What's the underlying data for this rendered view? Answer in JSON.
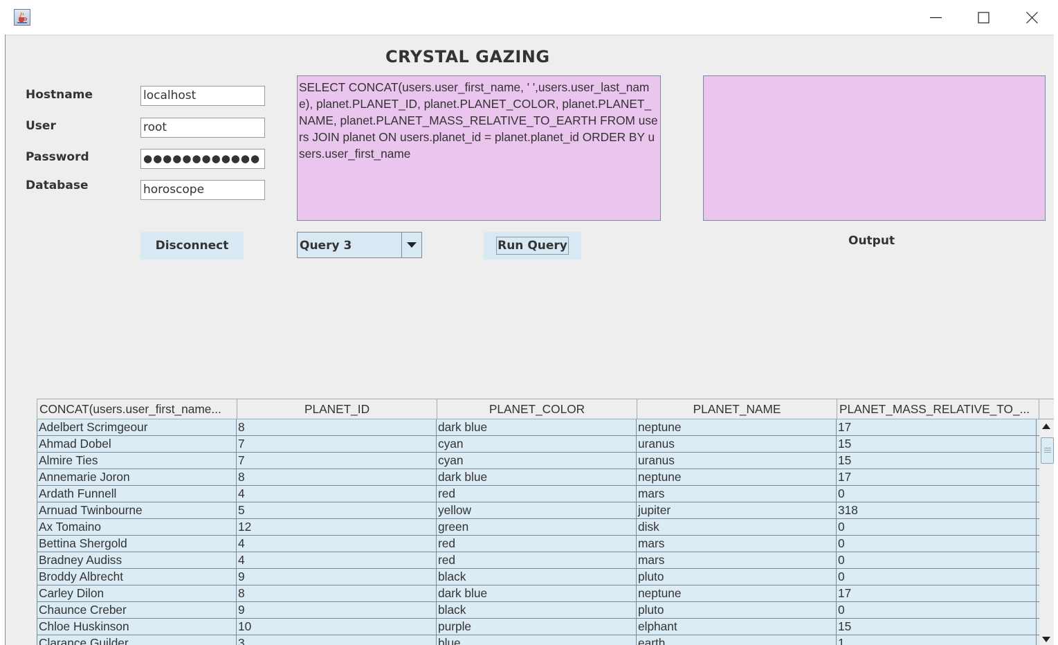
{
  "window": {
    "title": "",
    "icon": "java-cup-icon",
    "controls": [
      "minimize-icon",
      "maximize-icon",
      "close-icon"
    ]
  },
  "app": {
    "title": "CRYSTAL GAZING"
  },
  "connection": {
    "hostname_label": "Hostname",
    "hostname_value": "localhost",
    "user_label": "User",
    "user_value": "root",
    "password_label": "Password",
    "password_value": "●●●●●●●●●●●●",
    "database_label": "Database",
    "database_value": "horoscope",
    "disconnect_label": "Disconnect"
  },
  "query": {
    "text": "SELECT CONCAT(users.user_first_name, ' ',users.user_last_name), planet.PLANET_ID, planet.PLANET_COLOR, planet.PLANET_NAME, planet.PLANET_MASS_RELATIVE_TO_EARTH FROM users JOIN planet ON users.planet_id = planet.planet_id ORDER BY users.user_first_name",
    "selected": "Query 3",
    "run_label": "Run Query"
  },
  "output": {
    "label": "Output",
    "text": ""
  },
  "results": {
    "columns": [
      "CONCAT(users.user_first_name...",
      "PLANET_ID",
      "PLANET_COLOR",
      "PLANET_NAME",
      "PLANET_MASS_RELATIVE_TO_..."
    ],
    "rows": [
      [
        "Adelbert Scrimgeour",
        "8",
        "dark blue",
        "neptune",
        "17"
      ],
      [
        "Ahmad Dobel",
        "7",
        "cyan",
        "uranus",
        "15"
      ],
      [
        "Almire Ties",
        "7",
        "cyan",
        "uranus",
        "15"
      ],
      [
        "Annemarie Joron",
        "8",
        "dark blue",
        "neptune",
        "17"
      ],
      [
        "Ardath Funnell",
        "4",
        "red",
        "mars",
        "0"
      ],
      [
        "Arnuad Twinbourne",
        "5",
        "yellow",
        "jupiter",
        "318"
      ],
      [
        "Ax Tomaino",
        "12",
        "green",
        "disk",
        "0"
      ],
      [
        "Bettina Shergold",
        "4",
        "red",
        "mars",
        "0"
      ],
      [
        "Bradney Audiss",
        "4",
        "red",
        "mars",
        "0"
      ],
      [
        "Broddy Albrecht",
        "9",
        "black",
        "pluto",
        "0"
      ],
      [
        "Carley Dilon",
        "8",
        "dark blue",
        "neptune",
        "17"
      ],
      [
        "Chaunce Creber",
        "9",
        "black",
        "pluto",
        "0"
      ],
      [
        "Chloe Huskinson",
        "10",
        "purple",
        "elphant",
        "15"
      ],
      [
        "Clarance Guilder",
        "3",
        "blue",
        "earth",
        "1"
      ]
    ]
  },
  "colors": {
    "text_area_bg": "#eac5ee",
    "button_bg": "#d8e9f3",
    "row_bg": "#dcecf4",
    "panel_bg": "#eeeeee"
  }
}
